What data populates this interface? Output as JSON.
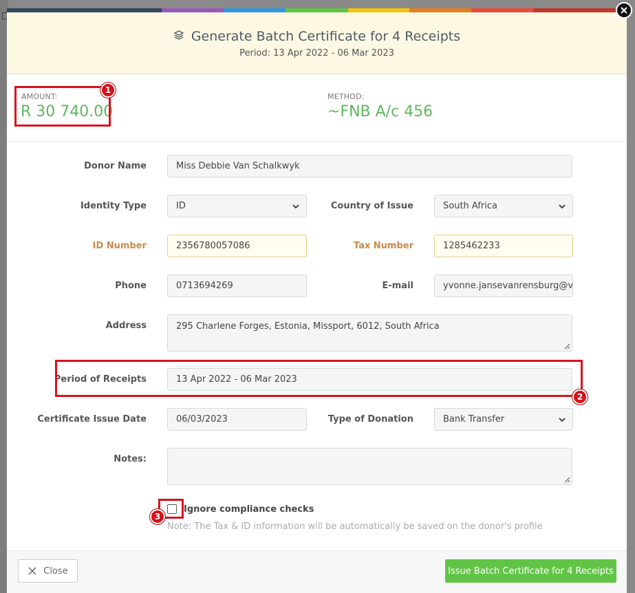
{
  "colors": {
    "bar": [
      "#34495e",
      "#9b59b6",
      "#3498db",
      "#62c447",
      "#f1c40f",
      "#e67e22",
      "#e74c3c",
      "#c0392b"
    ],
    "green": "#62c447",
    "annotation": "#d9111c"
  },
  "header": {
    "icon": "layers-icon",
    "title": "Generate Batch Certificate for 4 Receipts",
    "period": "Period: 13 Apr 2022 - 06 Mar 2023"
  },
  "summary": {
    "amount_label": "AMOUNT:",
    "amount_value": "R 30 740.00",
    "method_label": "METHOD:",
    "method_value": "~FNB A/c 456"
  },
  "form": {
    "donor_name": {
      "label": "Donor Name",
      "value": "Miss Debbie Van Schalkwyk"
    },
    "identity_type": {
      "label": "Identity Type",
      "value": "ID"
    },
    "country_of_issue": {
      "label": "Country of Issue",
      "value": "South Africa"
    },
    "id_number": {
      "label": "ID Number",
      "value": "2356780057086"
    },
    "tax_number": {
      "label": "Tax Number",
      "value": "1285462233"
    },
    "phone": {
      "label": "Phone",
      "value": "0713694269"
    },
    "email": {
      "label": "E-mail",
      "value": "yvonne.jansevanrensburg@v"
    },
    "address": {
      "label": "Address",
      "value": "295 Charlene Forges, Estonia, Missport, 6012, South Africa"
    },
    "period_of_receipts": {
      "label": "Period of Receipts",
      "value": "13 Apr 2022 - 06 Mar 2023"
    },
    "certificate_issue_date": {
      "label": "Certificate Issue Date",
      "value": "06/03/2023"
    },
    "type_of_donation": {
      "label": "Type of Donation",
      "value": "Bank Transfer"
    },
    "notes": {
      "label": "Notes:",
      "value": ""
    },
    "ignore_compliance": {
      "label": "Ignore compliance checks",
      "checked": false
    },
    "note": "Note: The Tax & ID information will be automatically be saved on the donor's profile"
  },
  "footer": {
    "close_label": "Close",
    "issue_label": "Issue Batch Certificate for 4 Receipts"
  },
  "annotations": [
    "1",
    "2",
    "3"
  ]
}
